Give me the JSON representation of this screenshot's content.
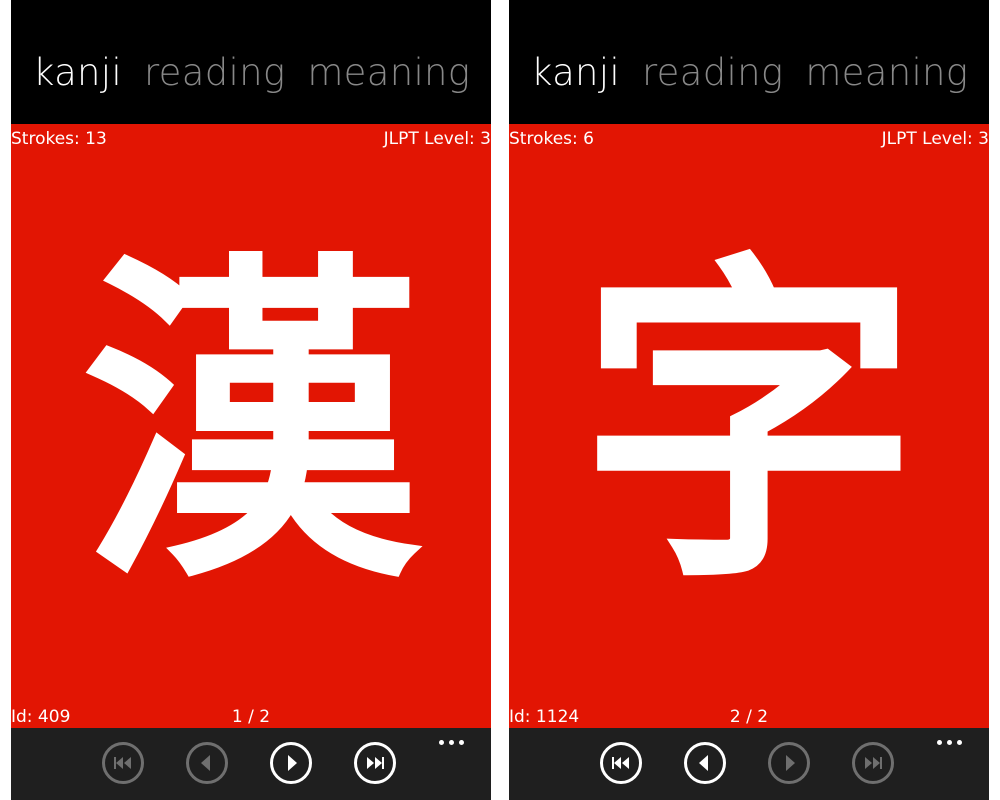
{
  "colors": {
    "card_background": "#e21503",
    "active_tab": "#ffffff",
    "inactive_tab": "#888888",
    "app_bar": "#1f1f1f",
    "disabled_button": "#6f6f6f"
  },
  "screens": [
    {
      "tabs": [
        {
          "label": "kanji",
          "active": true
        },
        {
          "label": "reading",
          "active": false
        },
        {
          "label": "meaning",
          "active": false
        }
      ],
      "card": {
        "strokes": "Strokes: 13",
        "jlpt": "JLPT Level: 3",
        "kanji": "漢",
        "id": "Id: 409",
        "page": "1 / 2"
      },
      "app_bar": {
        "buttons": [
          {
            "icon": "skip-first-icon",
            "enabled": false
          },
          {
            "icon": "previous-icon",
            "enabled": false
          },
          {
            "icon": "next-icon",
            "enabled": true
          },
          {
            "icon": "skip-last-icon",
            "enabled": true
          }
        ],
        "more_icon": "ellipsis-icon"
      }
    },
    {
      "tabs": [
        {
          "label": "kanji",
          "active": true
        },
        {
          "label": "reading",
          "active": false
        },
        {
          "label": "meaning",
          "active": false
        }
      ],
      "card": {
        "strokes": "Strokes: 6",
        "jlpt": "JLPT Level: 3",
        "kanji": "字",
        "id": "Id: 1124",
        "page": "2 / 2"
      },
      "app_bar": {
        "buttons": [
          {
            "icon": "skip-first-icon",
            "enabled": true
          },
          {
            "icon": "previous-icon",
            "enabled": true
          },
          {
            "icon": "next-icon",
            "enabled": false
          },
          {
            "icon": "skip-last-icon",
            "enabled": false
          }
        ],
        "more_icon": "ellipsis-icon"
      }
    }
  ]
}
